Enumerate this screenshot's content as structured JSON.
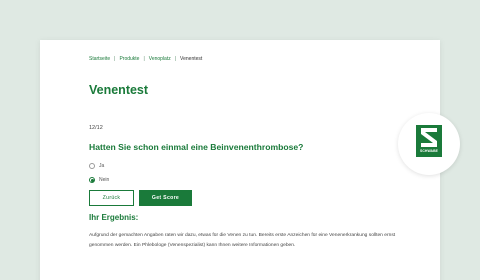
{
  "breadcrumb": {
    "items": [
      "Startseite",
      "Produkte",
      "Venoplatz"
    ],
    "current": "Venentest",
    "separator": "|"
  },
  "page_title": "Venentest",
  "quiz": {
    "counter": "12/12",
    "question": "Hatten Sie schon einmal eine Beinvenenthrombose?",
    "options": [
      {
        "label": "Ja",
        "selected": false
      },
      {
        "label": "Nein",
        "selected": true
      }
    ],
    "back_label": "Zurück",
    "score_label": "Get Score"
  },
  "result": {
    "title": "Ihr Ergebnis:",
    "text": "Aufgrund der gemachten Angaben raten wir dazu, etwas für die Venen zu tun. Bereits erste Anzeichen für eine Venenerkrankung sollten ernst genommen werden. Ein Phlebologe (Venenspezialist) kann Ihnen weitere Informationen geben."
  },
  "logo": {
    "word": "SCHWABE"
  },
  "colors": {
    "brand_green": "#1a7a3a",
    "background": "#dfe9e3"
  }
}
